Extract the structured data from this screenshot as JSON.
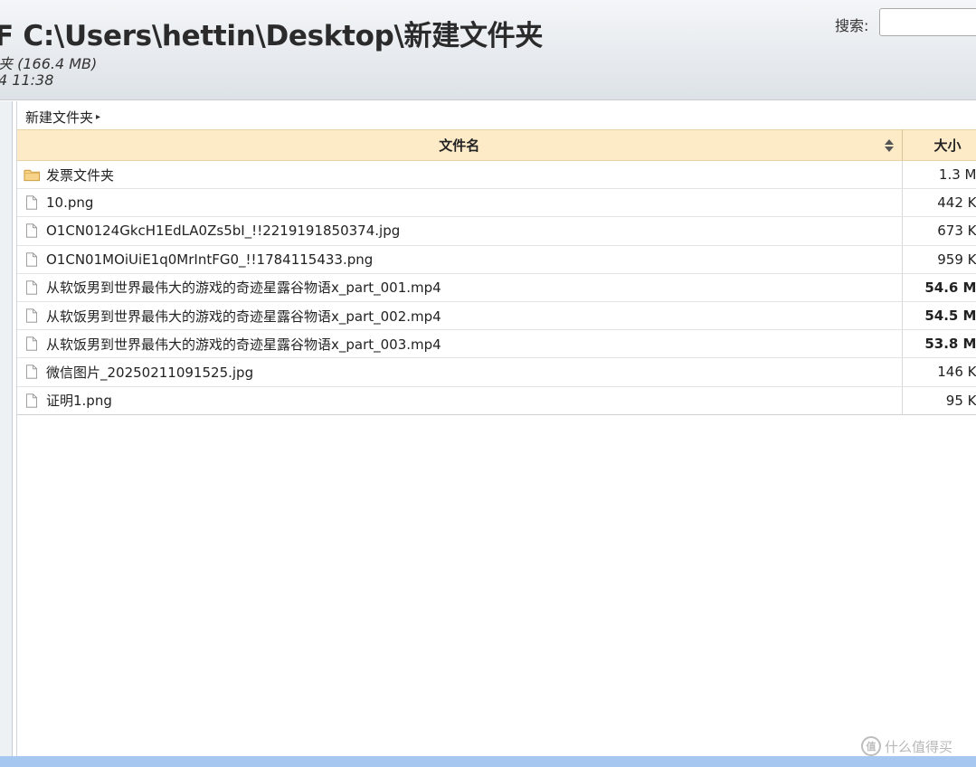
{
  "header": {
    "title": "F C:\\Users\\hettin\\Desktop\\新建文件夹",
    "size_line": "夹 (166.4 MB)",
    "date_line": "4 11:38"
  },
  "search": {
    "label": "搜索:",
    "value": ""
  },
  "breadcrumb": {
    "current": "新建文件夹",
    "arrow": "▸"
  },
  "table": {
    "columns": {
      "name": "文件名",
      "size": "大小"
    },
    "rows": [
      {
        "icon": "folder-icon",
        "name": "发票文件夹",
        "size": "1.3 M",
        "bold": false
      },
      {
        "icon": "file-icon",
        "name": "10.png",
        "size": "442 K",
        "bold": false
      },
      {
        "icon": "file-icon",
        "name": "O1CN0124GkcH1EdLA0Zs5bI_!!2219191850374.jpg",
        "size": "673 K",
        "bold": false
      },
      {
        "icon": "file-icon",
        "name": "O1CN01MOiUiE1q0MrIntFG0_!!1784115433.png",
        "size": "959 K",
        "bold": false
      },
      {
        "icon": "file-icon",
        "name": "从软饭男到世界最伟大的游戏的奇迹星露谷物语x_part_001.mp4",
        "size": "54.6 M",
        "bold": true
      },
      {
        "icon": "file-icon",
        "name": "从软饭男到世界最伟大的游戏的奇迹星露谷物语x_part_002.mp4",
        "size": "54.5 M",
        "bold": true
      },
      {
        "icon": "file-icon",
        "name": "从软饭男到世界最伟大的游戏的奇迹星露谷物语x_part_003.mp4",
        "size": "53.8 M",
        "bold": true
      },
      {
        "icon": "file-icon",
        "name": "微信图片_20250211091525.jpg",
        "size": "146 K",
        "bold": false
      },
      {
        "icon": "file-icon",
        "name": "证明1.png",
        "size": "95 K",
        "bold": false
      }
    ]
  },
  "watermark": {
    "logo_text": "值",
    "text": "什么值得买"
  },
  "colors": {
    "header_bg": "#e6eaee",
    "table_header_bg": "#fdebc8",
    "bottom_bar": "#a6c8f0",
    "folder": "#f5c76a"
  }
}
